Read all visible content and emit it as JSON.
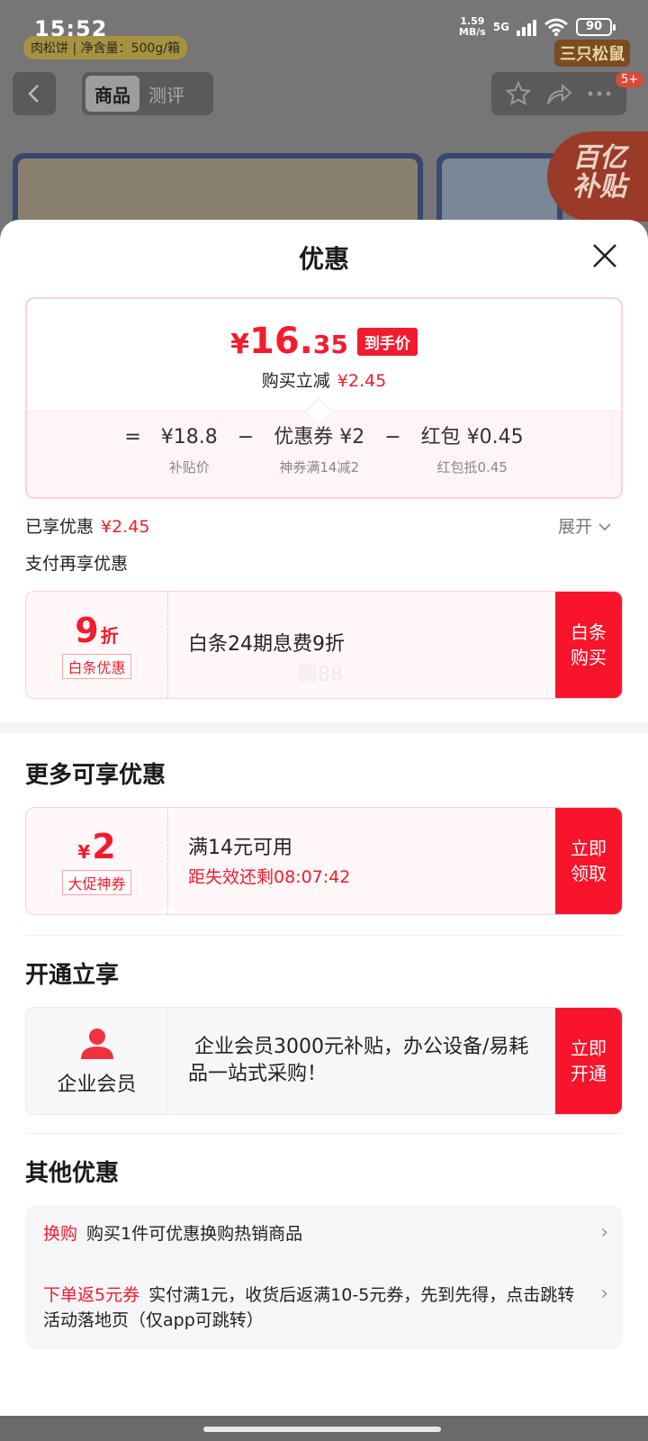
{
  "status_bar": {
    "time": "15:52",
    "net_speed_value": "1.59",
    "net_speed_unit": "MB/s",
    "signal_label": "5G",
    "battery": "90"
  },
  "nav": {
    "tabs": [
      {
        "label": "商品",
        "active": true
      },
      {
        "label": "测评",
        "active": false
      }
    ],
    "badge": "5+"
  },
  "background": {
    "tag_text": "肉松饼 | 净含量：500g/箱",
    "brand_text": "三只松鼠",
    "promo_text_1": "百亿",
    "promo_text_2": "补贴"
  },
  "sheet": {
    "title": "优惠",
    "price": {
      "yen": "¥",
      "integer": "16.",
      "decimal": "35",
      "tag": "到手价",
      "sub_label": "购买立减",
      "sub_value": "¥2.45"
    },
    "breakdown": [
      {
        "op": "=",
        "label": "¥18.8",
        "sub": "补贴价"
      },
      {
        "op": "−",
        "label": "优惠券 ¥2",
        "sub": "神券满14减2"
      },
      {
        "op": "−",
        "label": "红包 ¥0.45",
        "sub": "红包抵0.45"
      }
    ],
    "enjoyed_label": "已享优惠",
    "enjoyed_value": "¥2.45",
    "expand_label": "展开",
    "pay_more_label": "支付再享优惠",
    "baitiao": {
      "big": "9",
      "unit": "折",
      "chip": "白条优惠",
      "text": "白条24期息费9折",
      "watermark": "鹏88",
      "button": "白条购买"
    },
    "more_title": "更多可享优惠",
    "coupon": {
      "yen": "¥",
      "big": "2",
      "chip": "大促神券",
      "text": "满14元可用",
      "countdown": "距失效还剩08:07:42",
      "button": "立即领取"
    },
    "open_title": "开通立享",
    "member": {
      "label": "企业会员",
      "text": " 企业会员3000元补贴，办公设备/易耗品一站式采购！",
      "button": "立即开通"
    },
    "other_title": "其他优惠",
    "others": [
      {
        "tag": "换购",
        "text": "购买1件可优惠换购热销商品"
      },
      {
        "tag": "下单返5元券",
        "text": "实付满1元，收货后返满10-5元券，先到先得，点击跳转活动落地页（仅app可跳转）"
      }
    ]
  },
  "colors": {
    "accent": "#f21c2e",
    "button": "#f8142b",
    "dim_overlay": "#6a6a6a"
  }
}
